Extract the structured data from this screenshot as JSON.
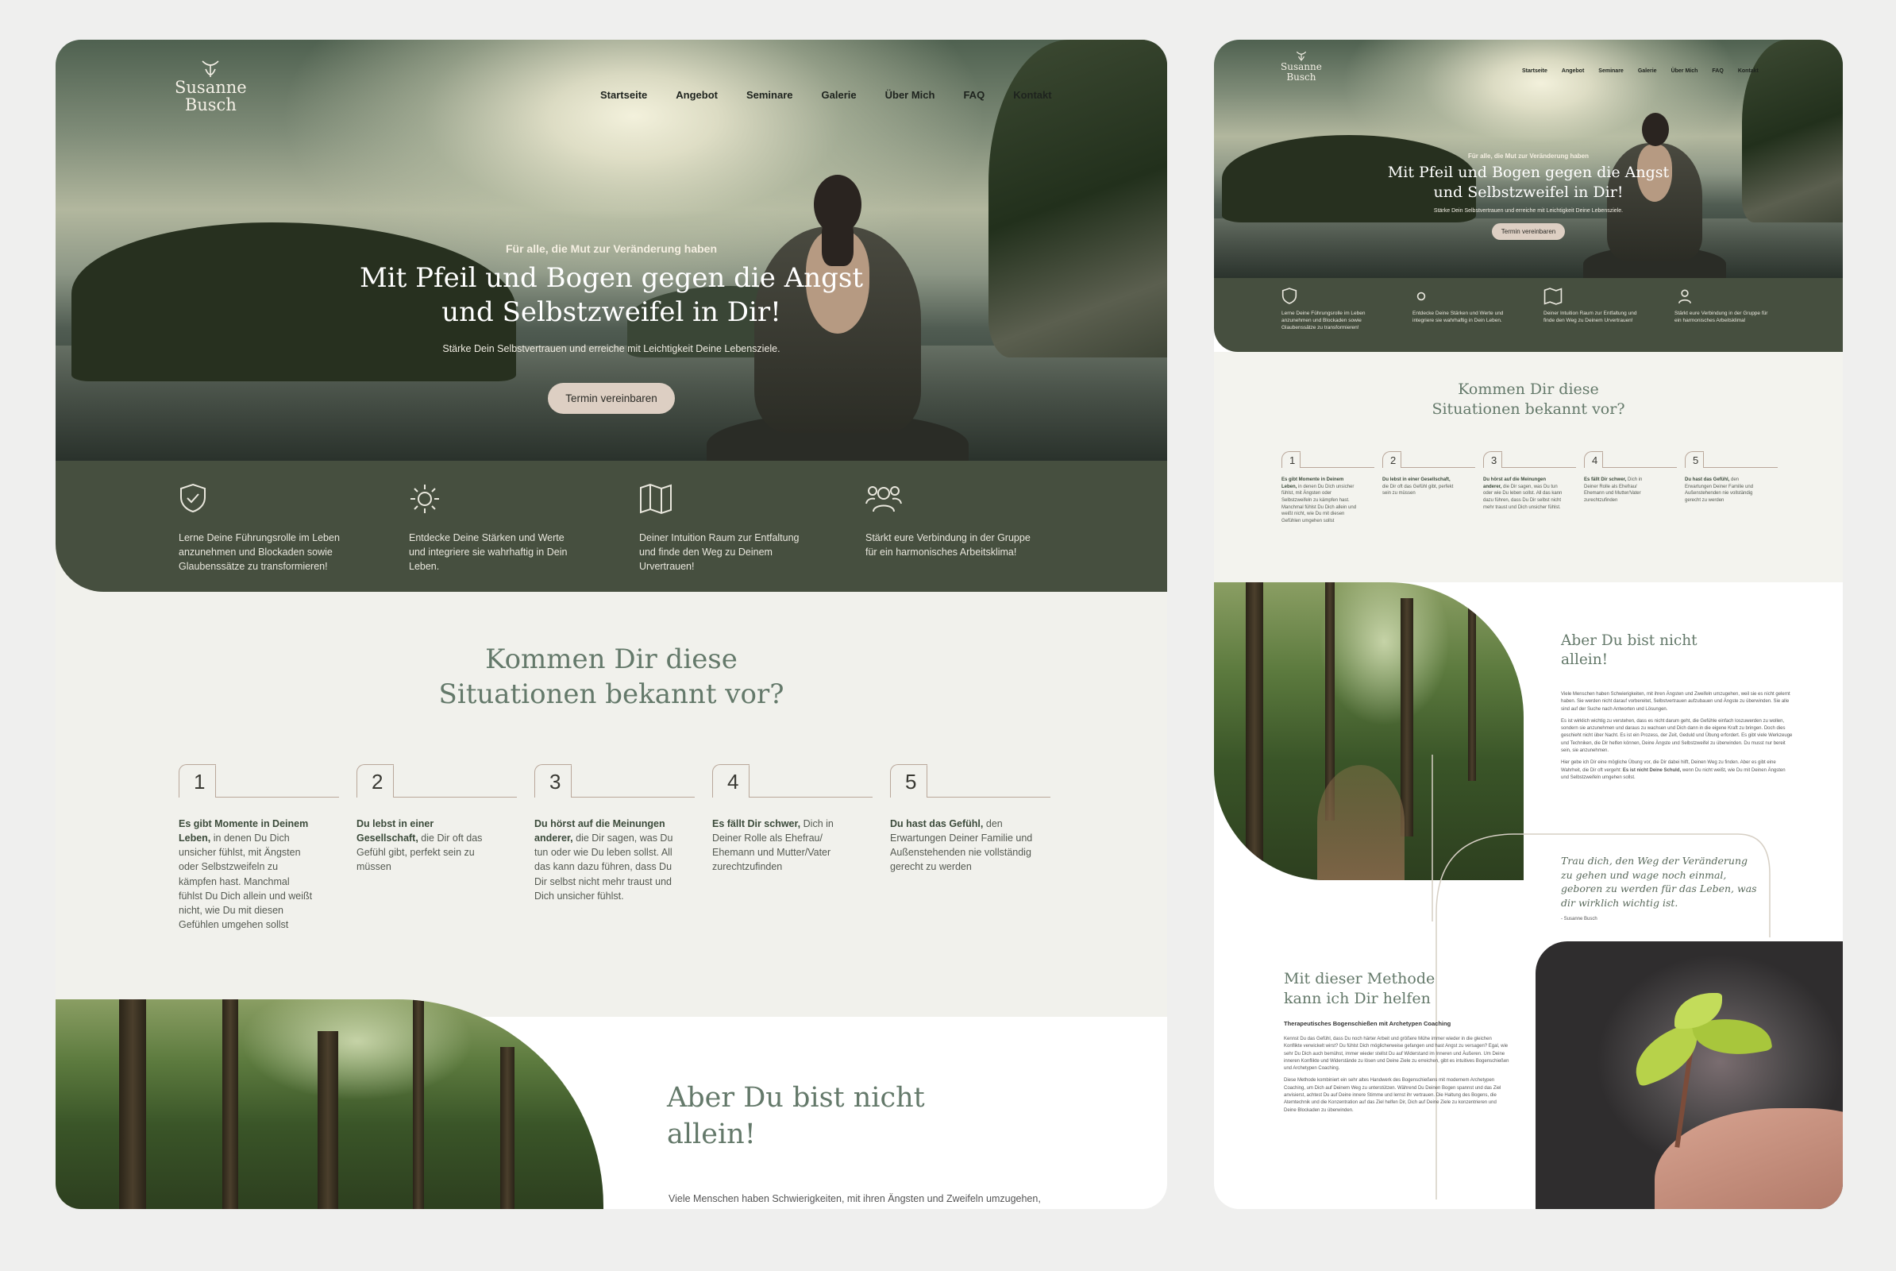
{
  "brand": {
    "first": "Susanne",
    "last": "Busch"
  },
  "nav": [
    "Startseite",
    "Angebot",
    "Seminare",
    "Galerie",
    "Über Mich",
    "FAQ",
    "Kontakt"
  ],
  "hero": {
    "subtitle": "Für alle, die Mut zur Veränderung haben",
    "title_line1": "Mit Pfeil und Bogen gegen die Angst",
    "title_line2": "und Selbstzweifel in Dir!",
    "lead": "Stärke Dein Selbstvertrauen und erreiche mit Leichtigkeit Deine Lebensziele.",
    "cta": "Termin vereinbaren"
  },
  "features": [
    {
      "icon": "shield-check-icon",
      "text": "Lerne Deine Führungsrolle im Leben anzunehmen und Blockaden sowie Glaubenssätze zu transformieren!"
    },
    {
      "icon": "sun-icon",
      "text": "Entdecke Deine Stärken und Werte und integriere sie wahrhaftig in Dein Leben."
    },
    {
      "icon": "map-icon",
      "text": "Deiner Intuition Raum zur Entfaltung und finde den Weg zu Deinem Urvertrauen!"
    },
    {
      "icon": "users-icon",
      "text": "Stärkt eure Verbindung in der Gruppe für ein harmonisches Arbeitsklima!"
    }
  ],
  "situations": {
    "title_line1": "Kommen Dir diese",
    "title_line2": "Situationen bekannt vor?",
    "steps": [
      {
        "num": "1",
        "bold": "Es gibt Momente in Deinem Leben,",
        "rest": " in denen Du Dich unsicher fühlst, mit Ängsten oder Selbstzweifeln zu kämpfen hast. Manchmal fühlst Du Dich allein und weißt nicht, wie Du mit diesen Gefühlen umgehen sollst"
      },
      {
        "num": "2",
        "bold": "Du lebst in einer Gesellschaft,",
        "rest": " die Dir oft das Gefühl gibt, perfekt sein zu müssen"
      },
      {
        "num": "3",
        "bold": "Du hörst auf die Meinungen anderer,",
        "rest": " die Dir sagen, was Du tun oder wie Du leben sollst. All das kann dazu führen, dass Du Dir selbst nicht mehr traust und Dich unsicher fühlst."
      },
      {
        "num": "4",
        "bold": "Es fällt Dir schwer,",
        "rest": " Dich in Deiner Rolle als Ehefrau/ Ehemann und Mutter/Vater zurechtzufinden"
      },
      {
        "num": "5",
        "bold": "Du hast das Gefühl,",
        "rest": " den Erwartungen Deiner Familie und Außenstehenden nie vollständig gerecht zu werden"
      }
    ]
  },
  "alone": {
    "title_line1": "Aber Du bist nicht",
    "title_line2": "allein!",
    "p1_start": "Viele Menschen haben Schwierigkeiten, mit ihren Ängsten und Zweifeln umzugehen,",
    "p1": "Viele Menschen haben Schwierigkeiten, mit ihren Ängsten und Zweifeln umzugehen, weil sie es nicht gelernt haben. Sie werden nicht darauf vorbereitet, Selbstvertrauen aufzubauen und Ängste zu überwinden. Sie alle sind auf der Suche nach Antworten und Lösungen.",
    "p2": "Es ist wirklich wichtig zu verstehen, dass es nicht darum geht, die Gefühle einfach loszuwerden zu wollen, sondern sie anzunehmen und daraus zu wachsen und Dich dann in die eigene Kraft zu bringen. Doch dies geschieht nicht über Nacht. Es ist ein Prozess, der Zeit, Geduld und Übung erfordert. Es gibt viele Werkzeuge und Techniken, die Dir helfen können, Deine Ängste und Selbstzweifel zu überwinden. Du musst nur bereit sein, sie anzunehmen.",
    "p3_start": "Hier gebe ich Dir eine mögliche Übung vor, die Dir dabei hilft, Deinen Weg zu finden. Aber es gibt eine Wahrheit, die Dir oft vergeht:",
    "p3_bold": "Es ist nicht Deine Schuld,",
    "p3_end": "wenn Du nicht weißt, wie Du mit Deinen Ängsten und Selbstzweifeln umgehen sollst."
  },
  "quote": {
    "text": "Trau dich, den Weg der Veränderung zu gehen und wage noch einmal, geboren zu werden für das Leben, was dir wirklich wichtig ist.",
    "author": "- Susanne Busch"
  },
  "method": {
    "title_line1": "Mit dieser Methode",
    "title_line2": "kann ich Dir helfen",
    "subtitle": "Therapeutisches Bogenschießen mit Archetypen Coaching",
    "p1": "Kennst Du das Gefühl, dass Du noch härter Arbeit und größere Mühe immer wieder in die gleichen Konflikte verwickelt wirst? Du fühlst Dich möglicherweise gefangen und hast Angst zu versagen? Egal, wie sehr Du Dich auch bemühst, immer wieder stellst Du auf Widerstand im Inneren und Äußeren. Um Deine inneren Konflikte und Widerstände zu lösen und Deine Ziele zu erreichen, gibt es intuitives Bogenschießen und Archetypen Coaching.",
    "p2": "Diese Methode kombiniert ein sehr altes Handwerk des Bogenschießens mit modernem Archetypen Coaching, um Dich auf Deinem Weg zu unterstützen. Während Du Deinen Bogen spannst und das Ziel anvisierst, achtest Du auf Deine innere Stimme und lernst ihr vertrauen. Die Haltung des Bogens, die Atemtechnik und die Konzentration auf das Ziel helfen Dir, Dich auf Deine Ziele zu konzentrieren und Deine Blockaden zu überwinden."
  },
  "colors": {
    "accent_green": "#464f3f",
    "title_green": "#64796a",
    "cta": "#ddcfc3"
  }
}
